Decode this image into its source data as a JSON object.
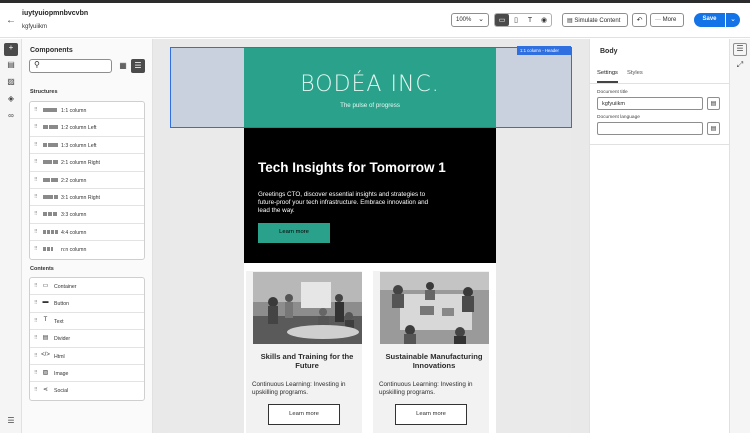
{
  "header": {
    "title": "iuytyuiopmnbvcvbn",
    "subtitle": "kgfyuiikm",
    "zoom": "100%",
    "simulate_label": "Simulate Content",
    "more_label": "More",
    "save_label": "Save"
  },
  "components": {
    "title": "Components",
    "search_placeholder": "",
    "structures_label": "Structures",
    "structures": [
      {
        "label": "1:1 column",
        "bars": [
          14
        ]
      },
      {
        "label": "1:2 column Left",
        "bars": [
          5,
          9
        ]
      },
      {
        "label": "1:3 column Left",
        "bars": [
          4,
          10
        ]
      },
      {
        "label": "2:1 column Right",
        "bars": [
          9,
          5
        ]
      },
      {
        "label": "2:2 column",
        "bars": [
          7,
          7
        ]
      },
      {
        "label": "3:1 column Right",
        "bars": [
          10,
          4
        ]
      },
      {
        "label": "3:3 column",
        "bars": [
          4,
          4,
          4
        ]
      },
      {
        "label": "4:4 column",
        "bars": [
          3,
          3,
          3,
          3
        ]
      },
      {
        "label": "n:n column",
        "bars": [
          3,
          3,
          2
        ]
      }
    ],
    "contents_label": "Contents",
    "contents": [
      {
        "label": "Container",
        "icon": "container-icon"
      },
      {
        "label": "Button",
        "icon": "button-icon"
      },
      {
        "label": "Text",
        "icon": "text-icon"
      },
      {
        "label": "Divider",
        "icon": "divider-icon"
      },
      {
        "label": "Html",
        "icon": "code-icon"
      },
      {
        "label": "Image",
        "icon": "image-icon"
      },
      {
        "label": "Social",
        "icon": "share-icon"
      }
    ]
  },
  "canvas": {
    "selection_tag": "1:1 column - Header",
    "logo": "BODÉA INC.",
    "tagline": "The pulse of progress",
    "hero_title": "Tech Insights for Tomorrow 1",
    "hero_body": "Greetings CTO, discover essential insights and strategies to future-proof your tech infrastructure. Embrace innovation and lead the way.",
    "hero_button": "Learn more",
    "cards": [
      {
        "title": "Skills and Training for the Future",
        "body": "Continuous Learning: Investing in upskilling programs.",
        "button": "Learn more"
      },
      {
        "title": "Sustainable Manufacturing Innovations",
        "body": "Continuous Learning: Investing in upskilling programs.",
        "button": "Learn more"
      }
    ]
  },
  "properties": {
    "title": "Body",
    "tab_settings": "Settings",
    "tab_styles": "Styles",
    "doc_title_label": "Document title",
    "doc_title_value": "kgfyuiikm",
    "doc_lang_label": "Document language",
    "doc_lang_value": ""
  },
  "colors": {
    "accent": "#1473e6",
    "teal": "#2aa28b",
    "selection": "#2f6fe0"
  }
}
